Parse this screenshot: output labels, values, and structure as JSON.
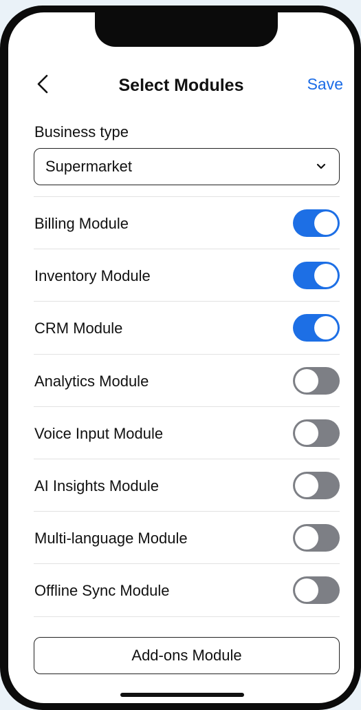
{
  "header": {
    "title": "Select Modules",
    "save_label": "Save"
  },
  "business": {
    "label": "Business type",
    "selected": "Supermarket"
  },
  "modules": [
    {
      "label": "Billing Module",
      "enabled": true
    },
    {
      "label": "Inventory Module",
      "enabled": true
    },
    {
      "label": "CRM Module",
      "enabled": true
    },
    {
      "label": "Analytics Module",
      "enabled": false
    },
    {
      "label": "Voice Input Module",
      "enabled": false
    },
    {
      "label": "AI Insights Module",
      "enabled": false
    },
    {
      "label": "Multi-language Module",
      "enabled": false
    },
    {
      "label": "Offline Sync Module",
      "enabled": false
    }
  ],
  "addons_button": "Add-ons Module",
  "colors": {
    "accent": "#1d6fe5",
    "toggle_off": "#7d7f85",
    "link": "#1a6be6"
  }
}
